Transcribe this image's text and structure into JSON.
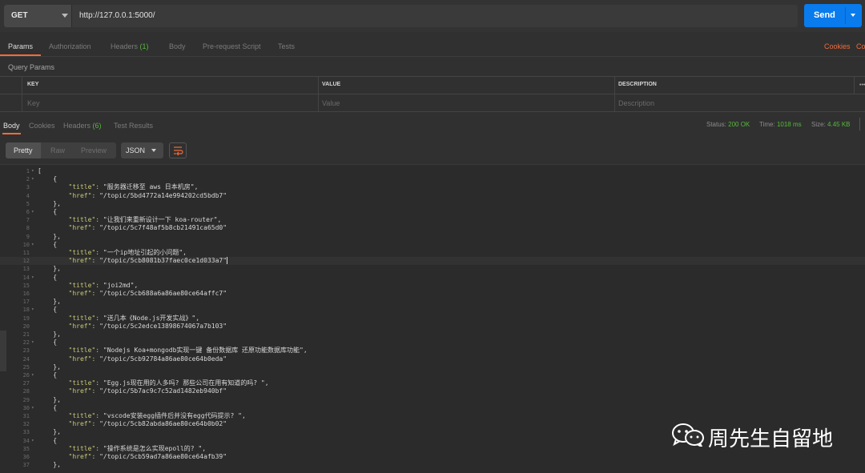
{
  "request": {
    "method": "GET",
    "url": "http://127.0.0.1:5000/",
    "send_label": "Send"
  },
  "request_tabs": [
    {
      "label": "Params",
      "active": true
    },
    {
      "label": "Authorization"
    },
    {
      "label": "Headers",
      "count": "(1)"
    },
    {
      "label": "Body"
    },
    {
      "label": "Pre-request Script"
    },
    {
      "label": "Tests"
    }
  ],
  "right_links": {
    "cookies": "Cookies",
    "code": "Co"
  },
  "query_params": {
    "title": "Query Params",
    "headers": [
      "KEY",
      "VALUE",
      "DESCRIPTION"
    ],
    "placeholders": [
      "Key",
      "Value",
      "Description"
    ],
    "more": "•••"
  },
  "response_tabs": [
    {
      "label": "Body",
      "active": true
    },
    {
      "label": "Cookies"
    },
    {
      "label": "Headers",
      "count": "(6)"
    },
    {
      "label": "Test Results"
    }
  ],
  "status": {
    "status_label": "Status:",
    "status_value": "200 OK",
    "time_label": "Time:",
    "time_value": "1018 ms",
    "size_label": "Size:",
    "size_value": "4.45 KB"
  },
  "view": {
    "modes": [
      "Pretty",
      "Raw",
      "Preview"
    ],
    "format": "JSON"
  },
  "code_lines": [
    {
      "n": "1",
      "fold": true,
      "text": "["
    },
    {
      "n": "2",
      "fold": true,
      "text": "    {"
    },
    {
      "n": "3",
      "key": "title",
      "value": "\"服务器迁移至 aws 日本机房\","
    },
    {
      "n": "4",
      "key": "href",
      "value": "\"/topic/5bd4772a14e994202cd5bdb7\""
    },
    {
      "n": "5",
      "text": "    },"
    },
    {
      "n": "6",
      "fold": true,
      "text": "    {"
    },
    {
      "n": "7",
      "key": "title",
      "value": "\"让我们来重新设计一下 koa-router\","
    },
    {
      "n": "8",
      "key": "href",
      "value": "\"/topic/5c7f48af5b8cb21491ca65d0\""
    },
    {
      "n": "9",
      "text": "    },"
    },
    {
      "n": "10",
      "fold": true,
      "text": "    {"
    },
    {
      "n": "11",
      "key": "title",
      "value": "\"一个ip地址引起的小问题\","
    },
    {
      "n": "12",
      "key": "href",
      "value": "\"/topic/5cb8081b37faec0ce1d033a7\"",
      "cursor": true
    },
    {
      "n": "13",
      "text": "    },"
    },
    {
      "n": "14",
      "fold": true,
      "text": "    {"
    },
    {
      "n": "15",
      "key": "title",
      "value": "\"joi2md\","
    },
    {
      "n": "16",
      "key": "href",
      "value": "\"/topic/5cb688a6a86ae80ce64affc7\""
    },
    {
      "n": "17",
      "text": "    },"
    },
    {
      "n": "18",
      "fold": true,
      "text": "    {"
    },
    {
      "n": "19",
      "key": "title",
      "value": "\"送几本《Node.js开发实战》\","
    },
    {
      "n": "20",
      "key": "href",
      "value": "\"/topic/5c2edce13898674067a7b103\""
    },
    {
      "n": "21",
      "text": "    },"
    },
    {
      "n": "22",
      "fold": true,
      "text": "    {"
    },
    {
      "n": "23",
      "key": "title",
      "value": "\"Nodejs Koa+mongodb实现一键 备份数据库 还原功能数据库功能\","
    },
    {
      "n": "24",
      "key": "href",
      "value": "\"/topic/5cb92784a86ae80ce64b0eda\""
    },
    {
      "n": "25",
      "text": "    },"
    },
    {
      "n": "26",
      "fold": true,
      "text": "    {"
    },
    {
      "n": "27",
      "key": "title",
      "value": "\"Egg.js现在用的人多吗? 那些公司在用有知道的吗? \","
    },
    {
      "n": "28",
      "key": "href",
      "value": "\"/topic/5b7ac9c7c52ad1482eb940bf\""
    },
    {
      "n": "29",
      "text": "    },"
    },
    {
      "n": "30",
      "fold": true,
      "text": "    {"
    },
    {
      "n": "31",
      "key": "title",
      "value": "\"vscode安装egg插件后并没有egg代码提示? \","
    },
    {
      "n": "32",
      "key": "href",
      "value": "\"/topic/5cb82abda86ae80ce64b0b02\""
    },
    {
      "n": "33",
      "text": "    },"
    },
    {
      "n": "34",
      "fold": true,
      "text": "    {"
    },
    {
      "n": "35",
      "key": "title",
      "value": "\"操作系统是怎么实现epoll的? \","
    },
    {
      "n": "36",
      "key": "href",
      "value": "\"/topic/5cb59ad7a86ae80ce64afb39\""
    },
    {
      "n": "37",
      "text": "    },"
    }
  ],
  "watermark": "周先生自留地",
  "colors": {
    "accent": "#f26b3a",
    "send": "#097bed",
    "success": "#55b93a",
    "json_key": "#c8c87a"
  }
}
